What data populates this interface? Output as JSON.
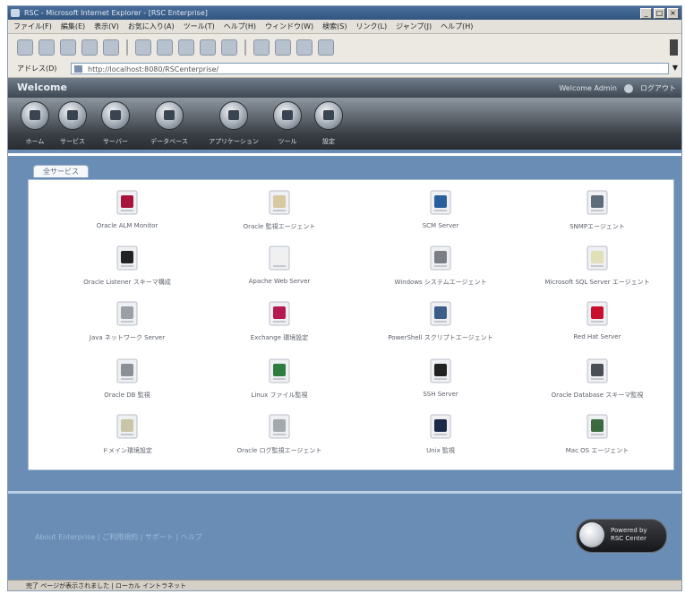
{
  "window": {
    "title": "RSC - Microsoft Internet Explorer - [RSC Enterprise]",
    "buttons": [
      "_",
      "□",
      "×"
    ]
  },
  "menu": [
    "ファイル(F)",
    "編集(E)",
    "表示(V)",
    "お気に入り(A)",
    "ツール(T)",
    "ヘルプ(H)",
    "ウィンドウ(W)",
    "検索(S)",
    "リンク(L)",
    "ジャンプ(J)",
    "ヘルプ(H)"
  ],
  "address": {
    "label": "アドレス(D)",
    "value": "http://localhost:8080/RSCenterprise/"
  },
  "app": {
    "brand": "Welcome",
    "right_links": [
      "Welcome Admin",
      "ログアウト"
    ]
  },
  "nav": [
    {
      "label": "ホーム"
    },
    {
      "label": "サービス"
    },
    {
      "label": "サーバー"
    },
    {
      "label": "データベース"
    },
    {
      "label": "アプリケーション"
    },
    {
      "label": "ツール"
    },
    {
      "label": "設定"
    }
  ],
  "tab": "全サービス",
  "grid": [
    {
      "label": "Oracle ALM Monitor",
      "icon": "pen-icon",
      "color": "#a8133a"
    },
    {
      "label": "Oracle 監視エージェント",
      "icon": "server-config-icon",
      "color": "#d8c9a0"
    },
    {
      "label": "SCM Server",
      "icon": "blue-monitor-icon",
      "color": "#2a5f9e"
    },
    {
      "label": "SNMPエージェント",
      "icon": "document-window-icon",
      "color": "#5d6b7a"
    },
    {
      "label": "Oracle Listener スキーマ構成",
      "icon": "black-tools-icon",
      "color": "#222222"
    },
    {
      "label": "Apache Web Server",
      "icon": "blank-page-icon",
      "color": "#f0f0f0"
    },
    {
      "label": "Windows システムエージェント",
      "icon": "server-arrow-icon",
      "color": "#7b7f85"
    },
    {
      "label": "Microsoft SQL Server エージェント",
      "icon": "storage-icon",
      "color": "#e1dfb8"
    },
    {
      "label": "Java ネットワーク Server",
      "icon": "chart-paper-icon",
      "color": "#9aa0a6"
    },
    {
      "label": "Exchange 環境設定",
      "icon": "exchange-icon",
      "color": "#b5194f"
    },
    {
      "label": "PowerShell スクリプトエージェント",
      "icon": "blue-panel-icon",
      "color": "#3b5d87"
    },
    {
      "label": "Red Hat Server",
      "icon": "red-pen-icon",
      "color": "#c8102e"
    },
    {
      "label": "Oracle DB 監視",
      "icon": "magnifier-icon",
      "color": "#8b9097"
    },
    {
      "label": "Linux ファイル監視",
      "icon": "green-gear-icon",
      "color": "#2e7d3e"
    },
    {
      "label": "SSH Server",
      "icon": "black-box-icon",
      "color": "#222222"
    },
    {
      "label": "Oracle Database スキーマ監視",
      "icon": "disk-icon",
      "color": "#4a4e55"
    },
    {
      "label": "ドメイン環境設定",
      "icon": "folder-doc-icon",
      "color": "#c9c6a7"
    },
    {
      "label": "Oracle ログ監視エージェント",
      "icon": "checklist-icon",
      "color": "#a4a9ae"
    },
    {
      "label": "Unix 監視",
      "icon": "u-icon",
      "color": "#1c2a4a"
    },
    {
      "label": "Mac OS エージェント",
      "icon": "computer-icon",
      "color": "#3b6a3f"
    }
  ],
  "footer": {
    "links": "About Enterprise  |  ご利用規約  |  サポート  |  ヘルプ",
    "powered": [
      "Powered by",
      "RSC Center"
    ]
  },
  "status": "完了  ページが表示されました  |  ローカル イントラネット"
}
